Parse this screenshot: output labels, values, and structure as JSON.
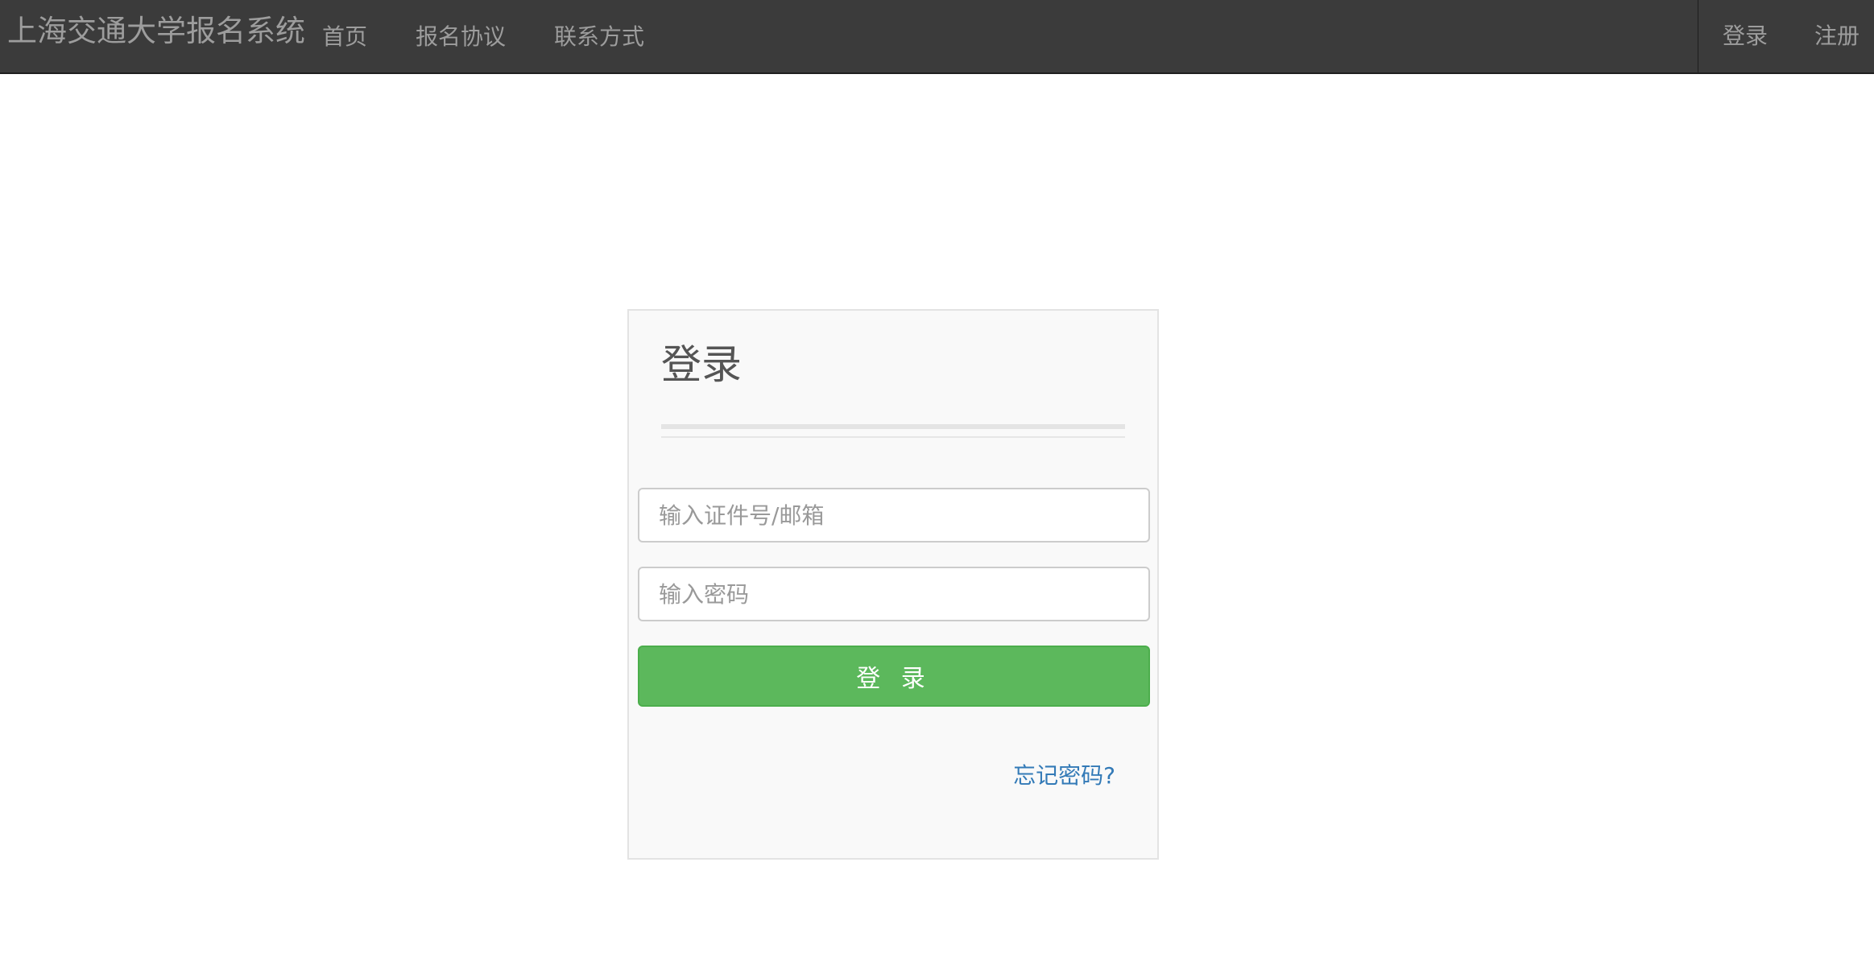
{
  "navbar": {
    "brand": "上海交通大学报名系统",
    "links": [
      {
        "label": "首页"
      },
      {
        "label": "报名协议"
      },
      {
        "label": "联系方式"
      }
    ],
    "right_links": [
      {
        "label": "登录"
      },
      {
        "label": "注册"
      }
    ]
  },
  "login_form": {
    "title": "登录",
    "account_placeholder": "输入证件号/邮箱",
    "password_placeholder": "输入密码",
    "submit_label": "登 录",
    "forgot_label": "忘记密码?"
  },
  "colors": {
    "navbar_bg": "#3b3b3b",
    "nav_text": "#9d9d9d",
    "card_bg": "#f9f9f9",
    "button_green": "#5cb85c",
    "link_blue": "#337ab7"
  }
}
